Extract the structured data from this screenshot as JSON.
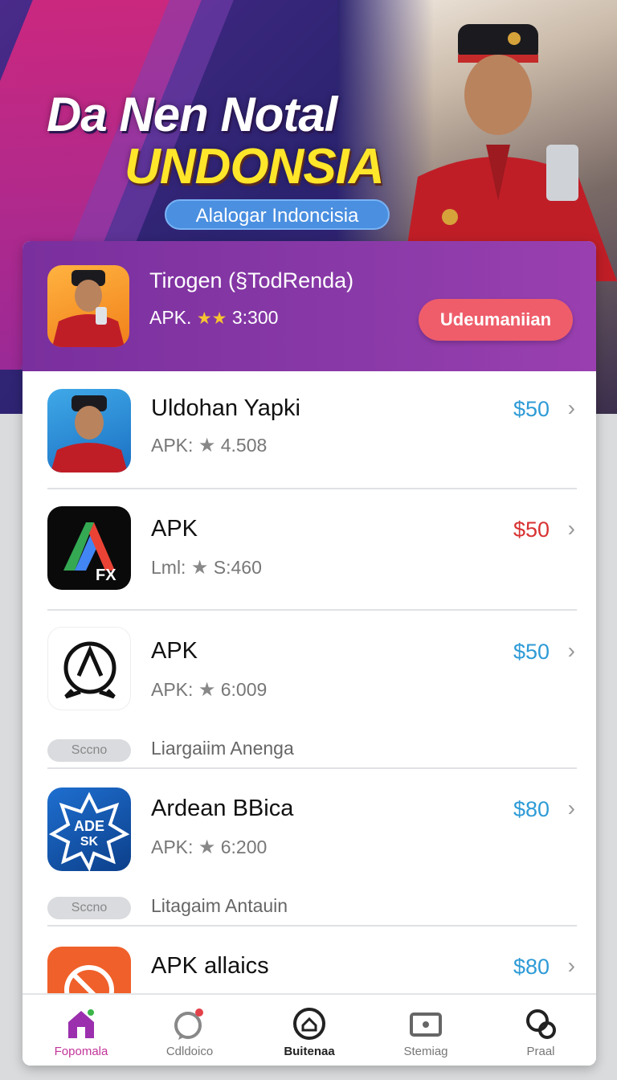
{
  "hero": {
    "title_line1": "Da Nen Notal",
    "title_line2": "UNDONSIA",
    "subtitle_pill": "Alalogar Indoncisia"
  },
  "featured": {
    "title": "Tirogen (§TodRenda)",
    "meta_prefix": "APK.",
    "stars": "★★",
    "meta_value": "3:300",
    "button_label": "Udeumaniian"
  },
  "list": {
    "items": [
      {
        "title": "Uldohan Yapki",
        "meta_prefix": "APK:",
        "meta_value": "4.508",
        "price": "$50",
        "price_color": "#2e9bd6",
        "icon": "person-photo-icon"
      },
      {
        "title": "APK",
        "meta_prefix": "Lml:",
        "meta_value": "S:460",
        "price": "$50",
        "price_color": "#d83232",
        "icon": "fx-app-icon"
      },
      {
        "title": "APK",
        "meta_prefix": "APK:",
        "meta_value": "6:009",
        "price": "$50",
        "price_color": "#2e9bd6",
        "icon": "chat-logo-icon"
      },
      {
        "title": "Ardean BBica",
        "meta_prefix": "APK:",
        "meta_value": "6:200",
        "price": "$80",
        "price_color": "#2e9bd6",
        "icon": "ade-sk-badge-icon"
      },
      {
        "title": "APK allaics",
        "price": "$80",
        "price_color": "#2e9bd6",
        "icon": "no-sign-icon"
      }
    ],
    "sections": [
      {
        "chip": "Sccno",
        "label": "Liargaiim Anenga"
      },
      {
        "chip": "Sccno",
        "label": "Litagaim Antauin"
      }
    ]
  },
  "tabbar": {
    "tabs": [
      {
        "label": "Fopomala",
        "icon": "home-icon",
        "active": true
      },
      {
        "label": "Cdldoico",
        "icon": "chat-bubble-icon"
      },
      {
        "label": "Buitenaa",
        "icon": "home-circle-icon"
      },
      {
        "label": "Stemiag",
        "icon": "screen-icon"
      },
      {
        "label": "Praal",
        "icon": "search-circles-icon"
      }
    ]
  }
}
